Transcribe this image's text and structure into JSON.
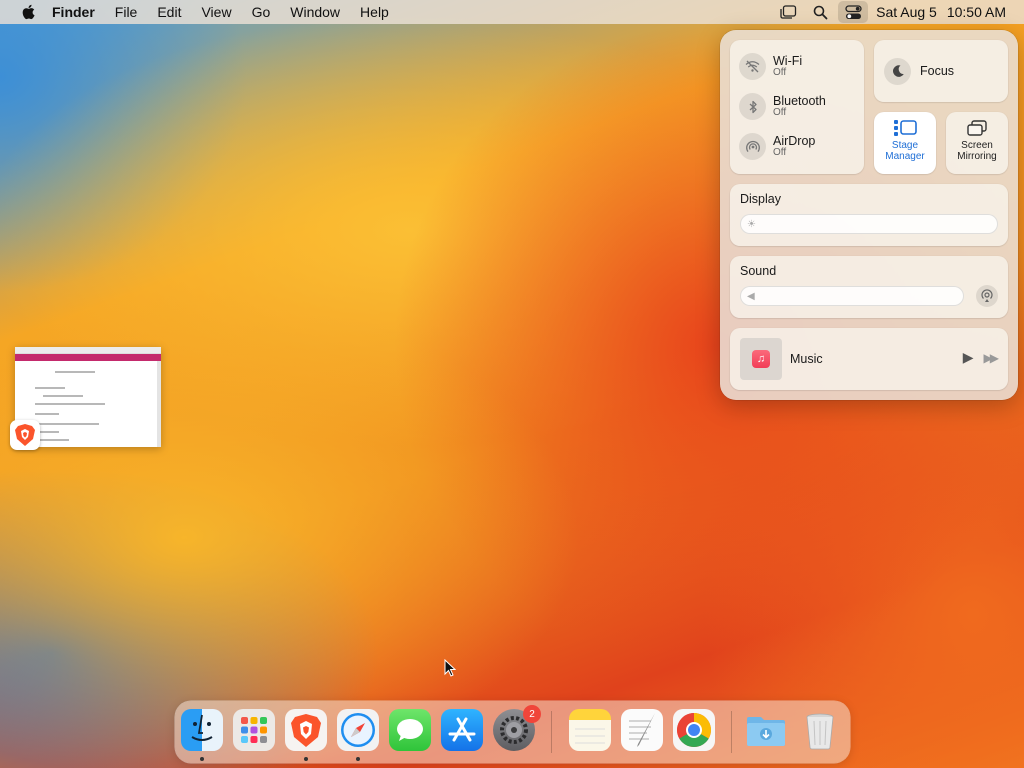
{
  "menubar": {
    "app_name": "Finder",
    "menus": [
      "File",
      "Edit",
      "View",
      "Go",
      "Window",
      "Help"
    ],
    "date": "Sat Aug 5",
    "time": "10:50 AM",
    "status_icons": [
      "stage-manager-icon",
      "spotlight-search-icon",
      "control-center-icon"
    ]
  },
  "control_center": {
    "wifi": {
      "title": "Wi-Fi",
      "status": "Off"
    },
    "bluetooth": {
      "title": "Bluetooth",
      "status": "Off"
    },
    "airdrop": {
      "title": "AirDrop",
      "status": "Off"
    },
    "focus": {
      "label": "Focus"
    },
    "stage_manager": {
      "label": "Stage Manager",
      "active": true,
      "accent": "#1f6fd6"
    },
    "screen_mirroring": {
      "label": "Screen Mirroring"
    },
    "display": {
      "label": "Display",
      "brightness": 0.0
    },
    "sound": {
      "label": "Sound",
      "volume": 0.0
    },
    "now_playing": {
      "label": "Music"
    }
  },
  "stage": {
    "app": "Brave Browser",
    "accent": "#c42a6c"
  },
  "dock": {
    "apps": [
      {
        "name": "Finder",
        "icon": "finder-icon",
        "running": true
      },
      {
        "name": "Launchpad",
        "icon": "launchpad-icon",
        "running": false
      },
      {
        "name": "Brave Browser",
        "icon": "brave-icon",
        "running": true
      },
      {
        "name": "Safari",
        "icon": "safari-icon",
        "running": true
      },
      {
        "name": "Messages",
        "icon": "messages-icon",
        "running": false
      },
      {
        "name": "App Store",
        "icon": "app-store-icon",
        "running": false
      },
      {
        "name": "System Settings",
        "icon": "system-settings-icon",
        "running": false,
        "badge": "2"
      },
      {
        "name": "Notes",
        "icon": "notes-icon",
        "running": false
      },
      {
        "name": "TextEdit",
        "icon": "textedit-icon",
        "running": false
      },
      {
        "name": "Google Chrome",
        "icon": "chrome-icon",
        "running": false
      },
      {
        "name": "Downloads",
        "icon": "downloads-folder-icon",
        "running": false
      },
      {
        "name": "Trash",
        "icon": "trash-icon",
        "running": false
      }
    ]
  }
}
